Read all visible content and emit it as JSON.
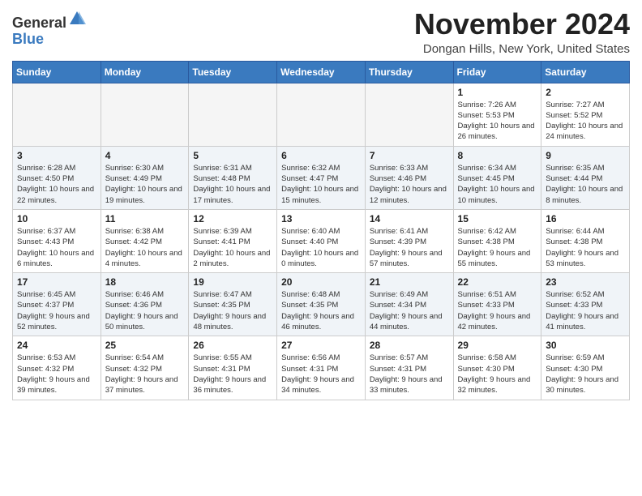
{
  "header": {
    "logo_line1": "General",
    "logo_line2": "Blue",
    "month": "November 2024",
    "location": "Dongan Hills, New York, United States"
  },
  "weekdays": [
    "Sunday",
    "Monday",
    "Tuesday",
    "Wednesday",
    "Thursday",
    "Friday",
    "Saturday"
  ],
  "weeks": [
    [
      {
        "day": "",
        "info": ""
      },
      {
        "day": "",
        "info": ""
      },
      {
        "day": "",
        "info": ""
      },
      {
        "day": "",
        "info": ""
      },
      {
        "day": "",
        "info": ""
      },
      {
        "day": "1",
        "info": "Sunrise: 7:26 AM\nSunset: 5:53 PM\nDaylight: 10 hours and 26 minutes."
      },
      {
        "day": "2",
        "info": "Sunrise: 7:27 AM\nSunset: 5:52 PM\nDaylight: 10 hours and 24 minutes."
      }
    ],
    [
      {
        "day": "3",
        "info": "Sunrise: 6:28 AM\nSunset: 4:50 PM\nDaylight: 10 hours and 22 minutes."
      },
      {
        "day": "4",
        "info": "Sunrise: 6:30 AM\nSunset: 4:49 PM\nDaylight: 10 hours and 19 minutes."
      },
      {
        "day": "5",
        "info": "Sunrise: 6:31 AM\nSunset: 4:48 PM\nDaylight: 10 hours and 17 minutes."
      },
      {
        "day": "6",
        "info": "Sunrise: 6:32 AM\nSunset: 4:47 PM\nDaylight: 10 hours and 15 minutes."
      },
      {
        "day": "7",
        "info": "Sunrise: 6:33 AM\nSunset: 4:46 PM\nDaylight: 10 hours and 12 minutes."
      },
      {
        "day": "8",
        "info": "Sunrise: 6:34 AM\nSunset: 4:45 PM\nDaylight: 10 hours and 10 minutes."
      },
      {
        "day": "9",
        "info": "Sunrise: 6:35 AM\nSunset: 4:44 PM\nDaylight: 10 hours and 8 minutes."
      }
    ],
    [
      {
        "day": "10",
        "info": "Sunrise: 6:37 AM\nSunset: 4:43 PM\nDaylight: 10 hours and 6 minutes."
      },
      {
        "day": "11",
        "info": "Sunrise: 6:38 AM\nSunset: 4:42 PM\nDaylight: 10 hours and 4 minutes."
      },
      {
        "day": "12",
        "info": "Sunrise: 6:39 AM\nSunset: 4:41 PM\nDaylight: 10 hours and 2 minutes."
      },
      {
        "day": "13",
        "info": "Sunrise: 6:40 AM\nSunset: 4:40 PM\nDaylight: 10 hours and 0 minutes."
      },
      {
        "day": "14",
        "info": "Sunrise: 6:41 AM\nSunset: 4:39 PM\nDaylight: 9 hours and 57 minutes."
      },
      {
        "day": "15",
        "info": "Sunrise: 6:42 AM\nSunset: 4:38 PM\nDaylight: 9 hours and 55 minutes."
      },
      {
        "day": "16",
        "info": "Sunrise: 6:44 AM\nSunset: 4:38 PM\nDaylight: 9 hours and 53 minutes."
      }
    ],
    [
      {
        "day": "17",
        "info": "Sunrise: 6:45 AM\nSunset: 4:37 PM\nDaylight: 9 hours and 52 minutes."
      },
      {
        "day": "18",
        "info": "Sunrise: 6:46 AM\nSunset: 4:36 PM\nDaylight: 9 hours and 50 minutes."
      },
      {
        "day": "19",
        "info": "Sunrise: 6:47 AM\nSunset: 4:35 PM\nDaylight: 9 hours and 48 minutes."
      },
      {
        "day": "20",
        "info": "Sunrise: 6:48 AM\nSunset: 4:35 PM\nDaylight: 9 hours and 46 minutes."
      },
      {
        "day": "21",
        "info": "Sunrise: 6:49 AM\nSunset: 4:34 PM\nDaylight: 9 hours and 44 minutes."
      },
      {
        "day": "22",
        "info": "Sunrise: 6:51 AM\nSunset: 4:33 PM\nDaylight: 9 hours and 42 minutes."
      },
      {
        "day": "23",
        "info": "Sunrise: 6:52 AM\nSunset: 4:33 PM\nDaylight: 9 hours and 41 minutes."
      }
    ],
    [
      {
        "day": "24",
        "info": "Sunrise: 6:53 AM\nSunset: 4:32 PM\nDaylight: 9 hours and 39 minutes."
      },
      {
        "day": "25",
        "info": "Sunrise: 6:54 AM\nSunset: 4:32 PM\nDaylight: 9 hours and 37 minutes."
      },
      {
        "day": "26",
        "info": "Sunrise: 6:55 AM\nSunset: 4:31 PM\nDaylight: 9 hours and 36 minutes."
      },
      {
        "day": "27",
        "info": "Sunrise: 6:56 AM\nSunset: 4:31 PM\nDaylight: 9 hours and 34 minutes."
      },
      {
        "day": "28",
        "info": "Sunrise: 6:57 AM\nSunset: 4:31 PM\nDaylight: 9 hours and 33 minutes."
      },
      {
        "day": "29",
        "info": "Sunrise: 6:58 AM\nSunset: 4:30 PM\nDaylight: 9 hours and 32 minutes."
      },
      {
        "day": "30",
        "info": "Sunrise: 6:59 AM\nSunset: 4:30 PM\nDaylight: 9 hours and 30 minutes."
      }
    ]
  ]
}
